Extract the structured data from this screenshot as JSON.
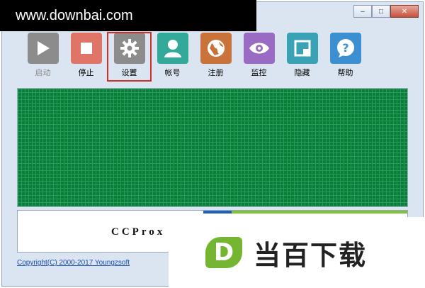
{
  "watermark": {
    "text": "www.downbai.com"
  },
  "window_controls": {
    "minimize": "–",
    "maximize": "□",
    "close": "✕"
  },
  "toolbar": {
    "items": [
      {
        "label": "启动",
        "icon": "play-icon",
        "color": "#8c8c8c",
        "disabled": true
      },
      {
        "label": "停止",
        "icon": "stop-icon",
        "color": "#e07467"
      },
      {
        "label": "设置",
        "icon": "gear-icon",
        "color": "#8c8c8c",
        "selected": true
      },
      {
        "label": "帐号",
        "icon": "user-icon",
        "color": "#33a99a"
      },
      {
        "label": "注册",
        "icon": "globe-icon",
        "color": "#c9733a"
      },
      {
        "label": "监控",
        "icon": "eye-icon",
        "color": "#9a6bc2"
      },
      {
        "label": "隐藏",
        "icon": "window-icon",
        "color": "#3aa2b5"
      },
      {
        "label": "帮助",
        "icon": "help-icon",
        "color": "#3c8fd0"
      }
    ]
  },
  "banner": {
    "text": "CCProx"
  },
  "status": {
    "copyright": "Copyright(C) 2000-2017 Youngzsoft"
  },
  "logo": {
    "mark": "D",
    "text": "当百下载"
  },
  "colors": {
    "grid": "#0e7a3c",
    "accent": "#74b632",
    "selection": "#d0302a"
  }
}
